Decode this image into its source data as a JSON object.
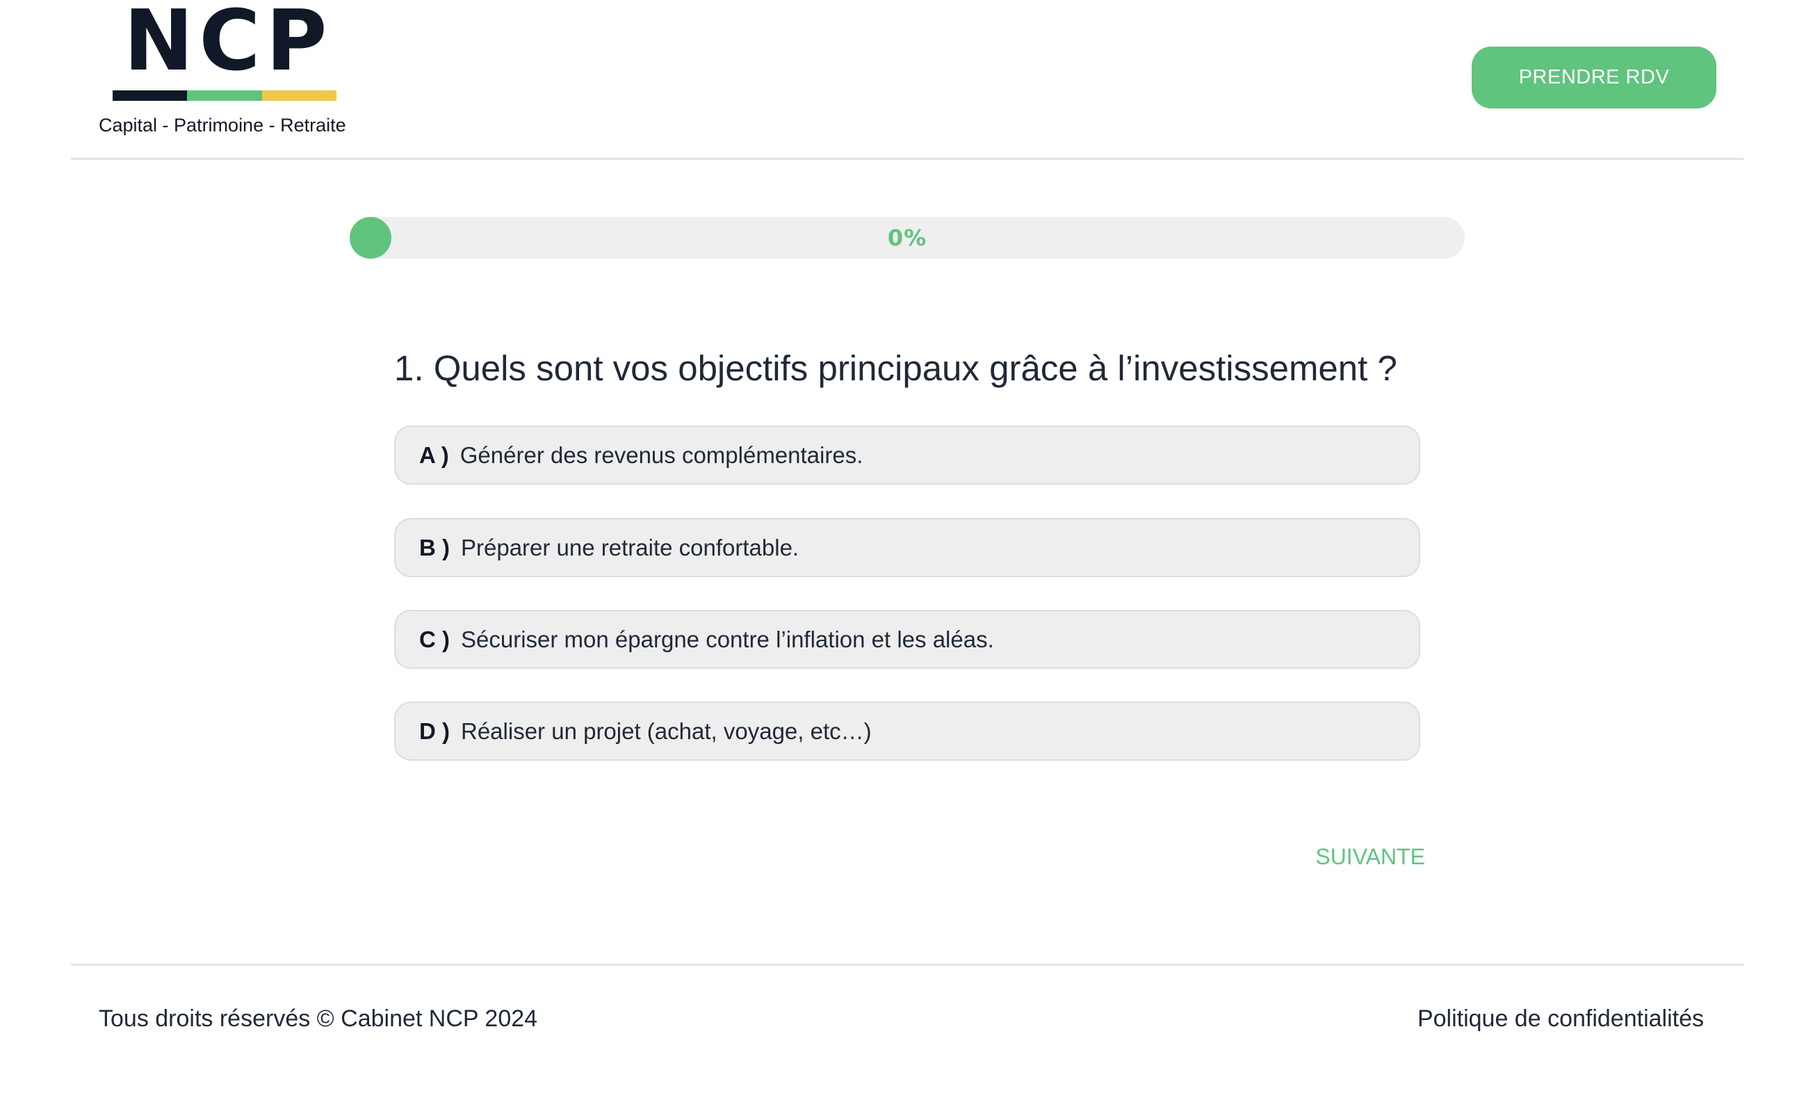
{
  "header": {
    "logo": {
      "letters": "NCP",
      "tagline": "Capital - Patrimoine - Retraite",
      "bar_colors": [
        "#111827",
        "#60c47e",
        "#ecc94b"
      ]
    },
    "cta_label": "PRENDRE RDV"
  },
  "progress": {
    "label": "0%",
    "value_percent": 0
  },
  "question": {
    "title": "1. Quels sont vos objectifs principaux grâce à l’investissement ?",
    "options": [
      {
        "letter": "A )",
        "text": "Générer des revenus complémentaires."
      },
      {
        "letter": "B )",
        "text": "Préparer une retraite confortable."
      },
      {
        "letter": "C )",
        "text": "Sécuriser mon épargne contre l’inflation et les aléas."
      },
      {
        "letter": "D )",
        "text": "Réaliser un projet (achat, voyage, etc…)"
      }
    ]
  },
  "navigation": {
    "next_label": "SUIVANTE"
  },
  "footer": {
    "copyright": "Tous droits réservés © Cabinet NCP 2024",
    "privacy_link": "Politique de confidentialités"
  },
  "colors": {
    "accent": "#60c47e",
    "text_dark": "#111827",
    "option_bg": "#eeeeee",
    "progress_track": "#efefef"
  }
}
